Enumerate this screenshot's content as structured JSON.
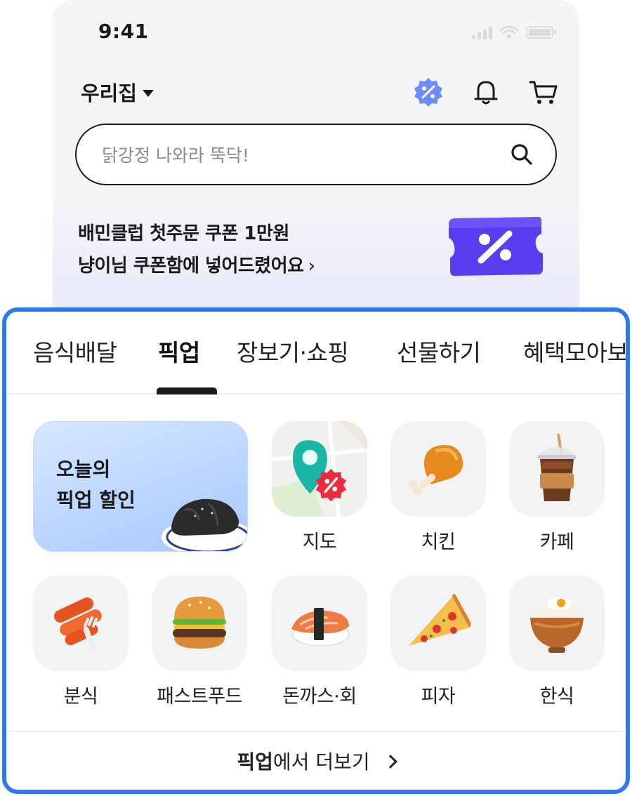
{
  "status": {
    "time": "9:41"
  },
  "header": {
    "address": "우리집"
  },
  "search": {
    "placeholder": "닭강정 나와라 뚝닥!"
  },
  "promo": {
    "line1": "배민클럽 첫주문 쿠폰 1만원",
    "line2": "냥이님 쿠폰함에 넣어드렸어요",
    "arrow": "›"
  },
  "tabs": [
    {
      "label": "음식배달",
      "active": false
    },
    {
      "label": "픽업",
      "active": true
    },
    {
      "label": "장보기·쇼핑",
      "active": false
    },
    {
      "label": "선물하기",
      "active": false
    },
    {
      "label": "혜택모아보기",
      "active": false
    }
  ],
  "feature": {
    "line1": "오늘의",
    "line2": "픽업 할인"
  },
  "categories": [
    {
      "label": "지도",
      "icon": "map-pin-icon"
    },
    {
      "label": "치킨",
      "icon": "chicken-icon"
    },
    {
      "label": "카페",
      "icon": "coffee-icon"
    },
    {
      "label": "분식",
      "icon": "tteokbokki-icon"
    },
    {
      "label": "패스트푸드",
      "icon": "burger-icon"
    },
    {
      "label": "돈까스·회",
      "icon": "sushi-icon"
    },
    {
      "label": "피자",
      "icon": "pizza-icon"
    },
    {
      "label": "한식",
      "icon": "rice-bowl-icon"
    }
  ],
  "more": {
    "bold": "픽업",
    "rest": "에서 더보기"
  },
  "colors": {
    "accent": "#2a79f0",
    "coupon": "#5a3df0"
  }
}
